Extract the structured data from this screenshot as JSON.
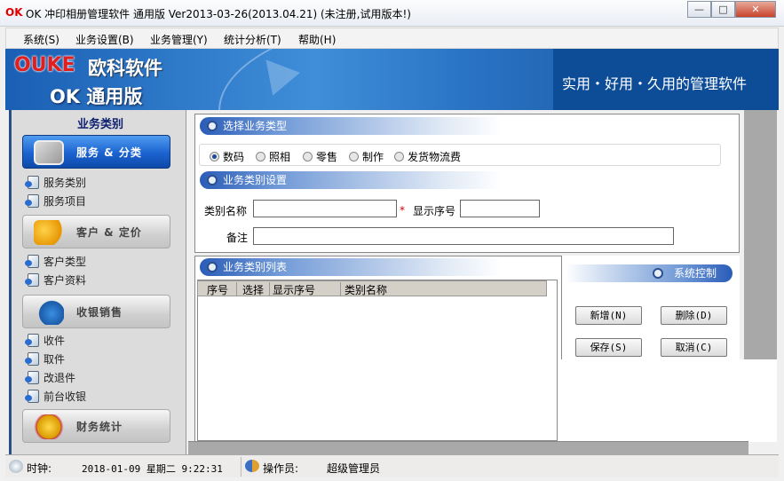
{
  "window": {
    "logo": "OK",
    "title": "OK 冲印相册管理软件 通用版 Ver2013-03-26(2013.04.21) (未注册,试用版本!)",
    "min": "—",
    "max": "□",
    "close": "✕"
  },
  "menu": [
    "系统(S)",
    "业务设置(B)",
    "业务管理(Y)",
    "统计分析(T)",
    "帮助(H)"
  ],
  "banner": {
    "brand": "OUKE",
    "brand_cn": "欧科软件",
    "edition": "OK 通用版",
    "slogan": "实用・好用・久用的管理软件"
  },
  "sidebar": {
    "title": "业务类别",
    "groups": [
      {
        "label": "服务 & 分类",
        "active": true,
        "items": [
          "服务类别",
          "服务项目"
        ]
      },
      {
        "label": "客户 & 定价",
        "items": [
          "客户类型",
          "客户资料"
        ]
      },
      {
        "label": "收银销售",
        "items": [
          "收件",
          "取件",
          "改退件",
          "前台收银"
        ]
      },
      {
        "label": "财务统计",
        "items": []
      }
    ]
  },
  "form": {
    "section_type": "选择业务类型",
    "types": [
      "数码",
      "照相",
      "零售",
      "制作",
      "发货物流费"
    ],
    "selected_type": "数码",
    "section_settings": "业务类别设置",
    "name_label": "类别名称",
    "name_value": "",
    "required_mark": "*",
    "order_label": "显示序号",
    "order_value": "",
    "note_label": "备注",
    "note_value": ""
  },
  "list": {
    "title": "业务类别列表",
    "columns": [
      "序号",
      "选择",
      "显示序号",
      "类别名称"
    ],
    "rows": []
  },
  "control": {
    "title": "系统控制",
    "buttons": {
      "add": "新增(N)",
      "delete": "删除(D)",
      "save": "保存(S)",
      "cancel": "取消(C)"
    }
  },
  "status": {
    "clock_label": "时钟:",
    "clock_value": "2018-01-09 星期二 9:22:31",
    "operator_label": "操作员:",
    "operator_value": "超级管理员"
  },
  "colors": {
    "accent": "#1b62d0",
    "banner": "#2a73c4",
    "required": "#cc0000"
  }
}
